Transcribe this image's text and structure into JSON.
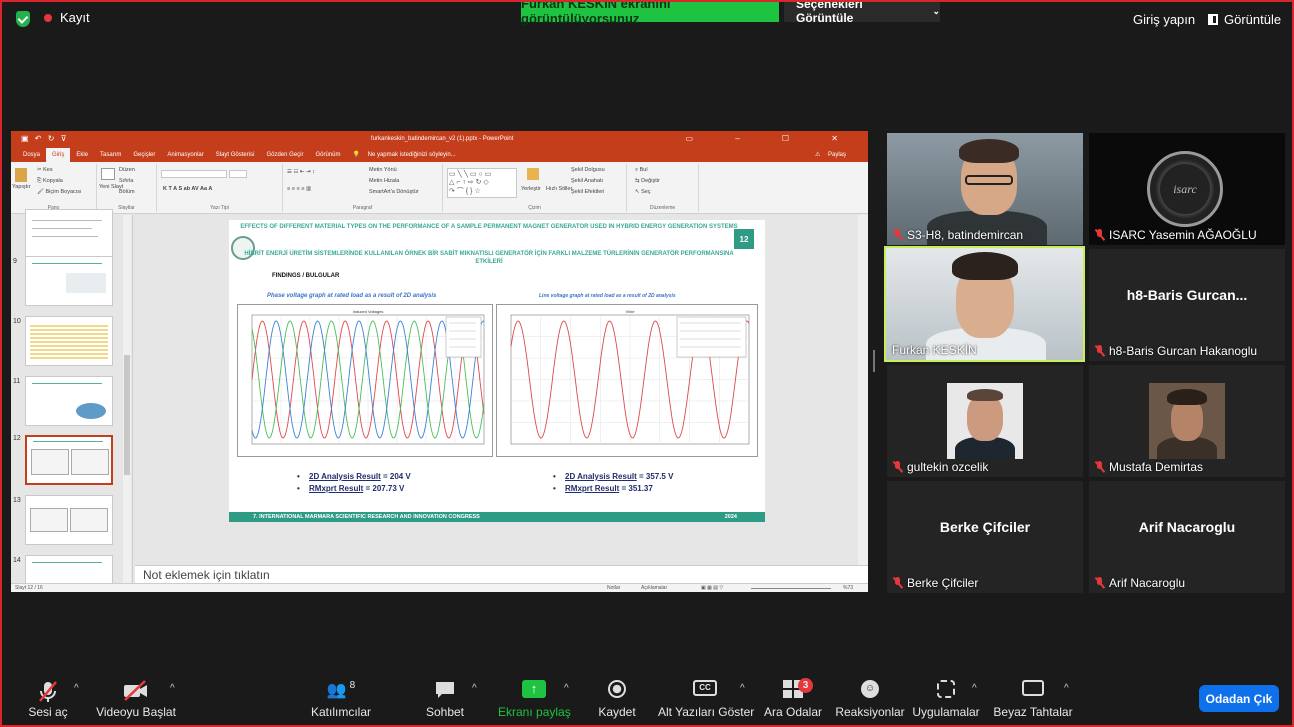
{
  "topbar": {
    "record_label": "Kayıt",
    "share_banner": "Furkan KESKİN ekranını görüntülüyorsunuz",
    "view_options": "Seçenekleri Görüntüle",
    "signin": "Giriş yapın",
    "view": "Görüntüle"
  },
  "ppt": {
    "filename": "furkankeskin_batindemircan_v2 (1).pptx - PowerPoint",
    "tabs": [
      "Dosya",
      "Giriş",
      "Ekle",
      "Tasarım",
      "Geçişler",
      "Animasyonlar",
      "Slayt Gösterisi",
      "Gözden Geçir",
      "Görünüm"
    ],
    "tellme": "Ne yapmak istediğinizi söyleyin...",
    "share": "Paylaş",
    "ribbon": {
      "paste": "Yapıştır",
      "cut": "Kes",
      "copy": "Kopyala",
      "format_painter": "Biçim Boyacısı",
      "new_slide": "Yeni Slayt",
      "layout": "Düzen",
      "reset": "Sıfırla",
      "section": "Bölüm",
      "text_direction": "Metin Yönü",
      "align_text": "Metin Hizala",
      "smartart": "SmartArt'a Dönüştür",
      "arrange": "Yerleştir",
      "quick_styles": "Hızlı Stiller",
      "shape_fill": "Şekil Dolgusu",
      "shape_outline": "Şekil Anahatı",
      "shape_effects": "Şekil Efektleri",
      "find": "Bul",
      "replace": "Değiştir",
      "select": "Seç",
      "groups": [
        "Pano",
        "Slaytlar",
        "Yazı Tipi",
        "Paragraf",
        "Çizim",
        "Düzenleme"
      ]
    },
    "thumb_numbers": [
      "9",
      "10",
      "11",
      "12",
      "13",
      "14"
    ],
    "notes": "Not eklemek için tıklatın",
    "status": {
      "slide": "Slayt 12 / 16",
      "notes": "Notlar",
      "comments": "Açıklamalar",
      "zoom": "%73"
    }
  },
  "slide": {
    "title_en": "EFFECTS OF DIFFERENT MATERIAL TYPES ON THE PERFORMANCE OF A SAMPLE PERMANENT MAGNET GENERATOR USED IN HYBRID ENERGY GENERATION SYSTEMS",
    "title_tr": "HİBRİT ENERJİ ÜRETİM SİSTEMLERİNDE KULLANILAN ÖRNEK BİR SABİT MIKNATISLI GENERATÖR İÇİN FARKLI MALZEME TÜRLERİNİN GENERATÖR PERFORMANSINA ETKİLERİ",
    "number": "12",
    "findings": "FINDINGS / BULGULAR",
    "caption_left": "Phase voltage graph at rated load as a result of 2D analysis",
    "caption_right": "Line voltage graph at rated load as a result of 2D analysis",
    "plot_left_title": "Induced Voltages",
    "plot_right_title": "Vline",
    "left_results": [
      {
        "label": "2D Analysis Result",
        "value": "=  204 V"
      },
      {
        "label": "RMxprt Result",
        "value": "= 207.73 V"
      }
    ],
    "right_results": [
      {
        "label": "2D Analysis Result",
        "value": "= 357.5 V"
      },
      {
        "label": "RMxprt Result",
        "value": "= 351.37"
      }
    ],
    "footer_left": "7. INTERNATIONAL MARMARA SCIENTIFIC RESEARCH AND INNOVATION CONGRESS",
    "footer_right": "2024"
  },
  "participants": [
    {
      "name": "S3-H8, batindemircan",
      "muted": true
    },
    {
      "name": "ISARC Yasemin AĞAOĞLU",
      "muted": true
    },
    {
      "name": "Furkan KESKİN",
      "muted": false,
      "active": true
    },
    {
      "name": "h8-Baris Gurcan Hakanoglu",
      "display": "h8-Baris Gurcan...",
      "muted": true
    },
    {
      "name": "gultekin ozcelik",
      "muted": true
    },
    {
      "name": "Mustafa Demirtas",
      "muted": true
    },
    {
      "name": "Berke Çifciler",
      "display": "Berke Çifciler",
      "muted": true
    },
    {
      "name": "Arif Nacaroglu",
      "display": "Arif Nacaroglu",
      "muted": true
    }
  ],
  "toolbar": {
    "mute": "Sesi aç",
    "video": "Videoyu Başlat",
    "participants": "Katılımcılar",
    "participants_count": "8",
    "chat": "Sohbet",
    "share": "Ekranı paylaş",
    "record": "Kaydet",
    "captions": "Alt Yazıları Göster",
    "captions_icon": "CC",
    "breakout": "Ara Odalar",
    "breakout_badge": "3",
    "reactions": "Reaksiyonlar",
    "apps": "Uygulamalar",
    "whiteboard": "Beyaz Tahtalar",
    "leave": "Odadan Çık"
  },
  "colors": {
    "share_green": "#1ec341",
    "ppt_red": "#c43e1c",
    "slide_teal": "#2e9c85",
    "leave_blue": "#0e71eb",
    "muted_red": "#e5383b",
    "active_border": "#c6ef58"
  }
}
